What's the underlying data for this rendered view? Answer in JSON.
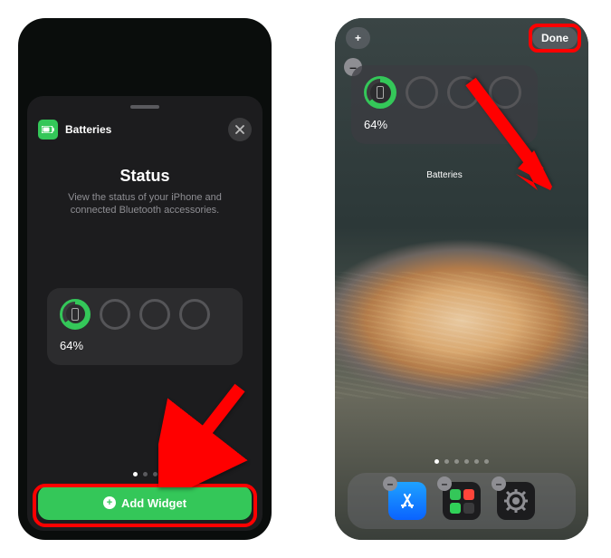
{
  "left": {
    "sheet_header": "Batteries",
    "title": "Status",
    "description": "View the status of your iPhone and connected Bluetooth accessories.",
    "battery_percent": "64%",
    "add_button": "Add Widget"
  },
  "right": {
    "add_label": "+",
    "done_label": "Done",
    "widget_label": "Batteries",
    "battery_percent": "64%"
  },
  "colors": {
    "accent_green": "#34c759",
    "highlight_red": "#ff0000"
  }
}
